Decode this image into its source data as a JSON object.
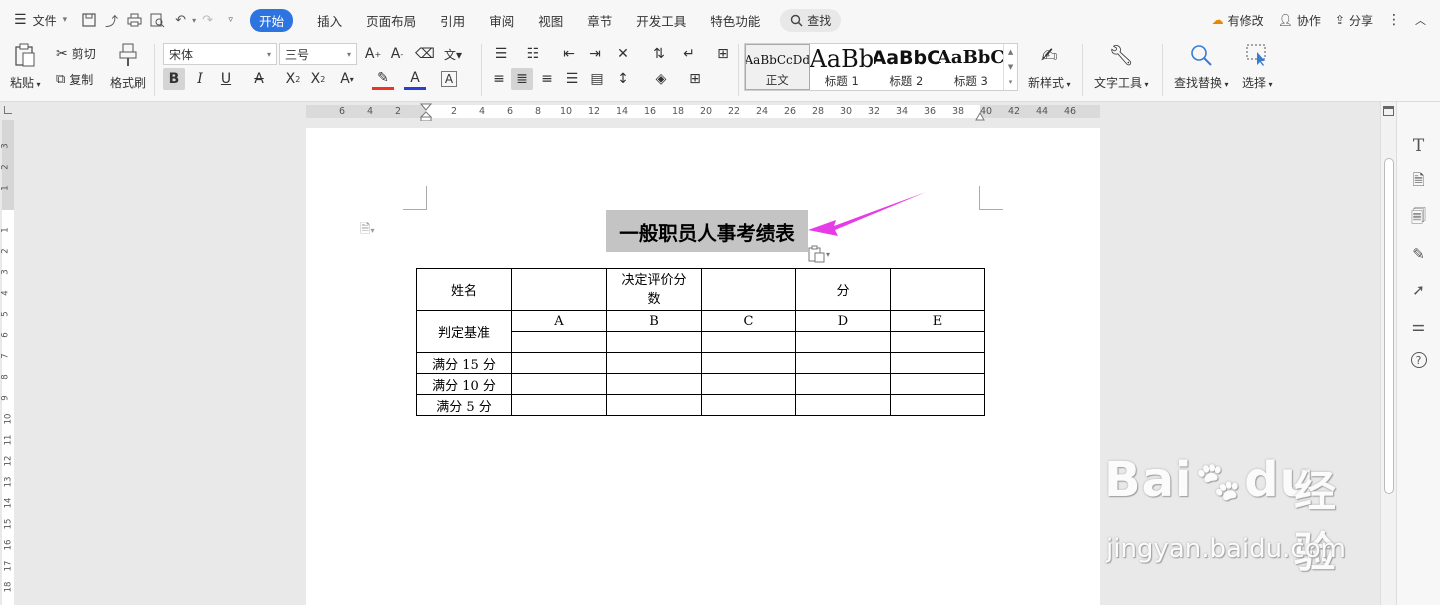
{
  "menubar": {
    "file_label": "文件",
    "tabs": [
      {
        "label": "开始",
        "active": true
      },
      {
        "label": "插入",
        "active": false
      },
      {
        "label": "页面布局",
        "active": false
      },
      {
        "label": "引用",
        "active": false
      },
      {
        "label": "审阅",
        "active": false
      },
      {
        "label": "视图",
        "active": false
      },
      {
        "label": "章节",
        "active": false
      },
      {
        "label": "开发工具",
        "active": false
      },
      {
        "label": "特色功能",
        "active": false
      }
    ],
    "search_label": "查找",
    "right": {
      "modified": "有修改",
      "collab": "协作",
      "share": "分享"
    },
    "accent_color": "#2e74e0"
  },
  "ribbon": {
    "paste": "粘贴",
    "cut": "剪切",
    "copy": "复制",
    "format_painter": "格式刷",
    "font_name": "宋体",
    "font_size": "三号",
    "styles": [
      {
        "preview": "AaBbCcDd",
        "label": "正文"
      },
      {
        "preview": "AaBb",
        "label": "标题 1"
      },
      {
        "preview": "AaBbC",
        "label": "标题 2"
      },
      {
        "preview": "AaBbC",
        "label": "标题 3"
      }
    ],
    "new_style": "新样式",
    "text_tools": "文字工具",
    "find_replace": "查找替换",
    "select": "选择"
  },
  "ruler": {
    "h_numbers": [
      "6",
      "4",
      "2",
      "2",
      "4",
      "6",
      "8",
      "10",
      "12",
      "14",
      "16",
      "18",
      "20",
      "22",
      "24",
      "26",
      "28",
      "30",
      "32",
      "34",
      "36",
      "38",
      "40",
      "42",
      "44",
      "46"
    ],
    "v_numbers": [
      "3",
      "2",
      "1",
      "1",
      "2",
      "3",
      "4",
      "5",
      "6",
      "7",
      "8",
      "9",
      "10",
      "11",
      "12",
      "13",
      "14",
      "15",
      "16",
      "17",
      "18"
    ]
  },
  "document": {
    "title": "一般职员人事考绩表",
    "table": {
      "row1": {
        "name": "姓名",
        "decide_score": "决定评价分数",
        "score": "分"
      },
      "row2_label": "判定基准",
      "grades": [
        "A",
        "B",
        "C",
        "D",
        "E"
      ],
      "rows": [
        "满分 15 分",
        "满分 10 分",
        "满分 5 分"
      ]
    }
  },
  "watermark": {
    "logo": "Bai",
    "logo2": "du",
    "cn": "经验",
    "url": "jingyan.baidu.com"
  }
}
